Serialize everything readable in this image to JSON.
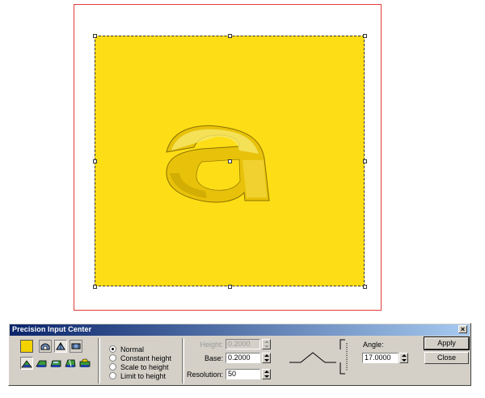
{
  "dialog": {
    "title": "Precision Input Center",
    "close_glyph": "×",
    "swatch_color": "#f2d200",
    "top_tools": [
      "dome-tool-icon",
      "pyramid-tool-icon",
      "extrude-tool-icon"
    ],
    "bottom_tools": [
      "style-tool-1-icon",
      "style-tool-2-icon",
      "style-tool-3-icon",
      "style-tool-4-icon",
      "style-tool-5-icon"
    ],
    "modes": [
      {
        "label": "Normal",
        "selected": true
      },
      {
        "label": "Constant height",
        "selected": false
      },
      {
        "label": "Scale to height",
        "selected": false
      },
      {
        "label": "Limit to height",
        "selected": false
      }
    ],
    "height": {
      "label": "Height:",
      "value": "0.2000",
      "enabled": false
    },
    "base": {
      "label": "Base:",
      "value": "0.2000"
    },
    "resolution": {
      "label": "Resolution:",
      "value": "50"
    },
    "angle": {
      "label": "Angle:",
      "value": "17.0000"
    },
    "apply_label": "Apply",
    "close_label": "Close"
  },
  "canvas": {
    "artwork_color": "#fddd16",
    "page_border_color": "#e23a3a",
    "letter": "a"
  }
}
